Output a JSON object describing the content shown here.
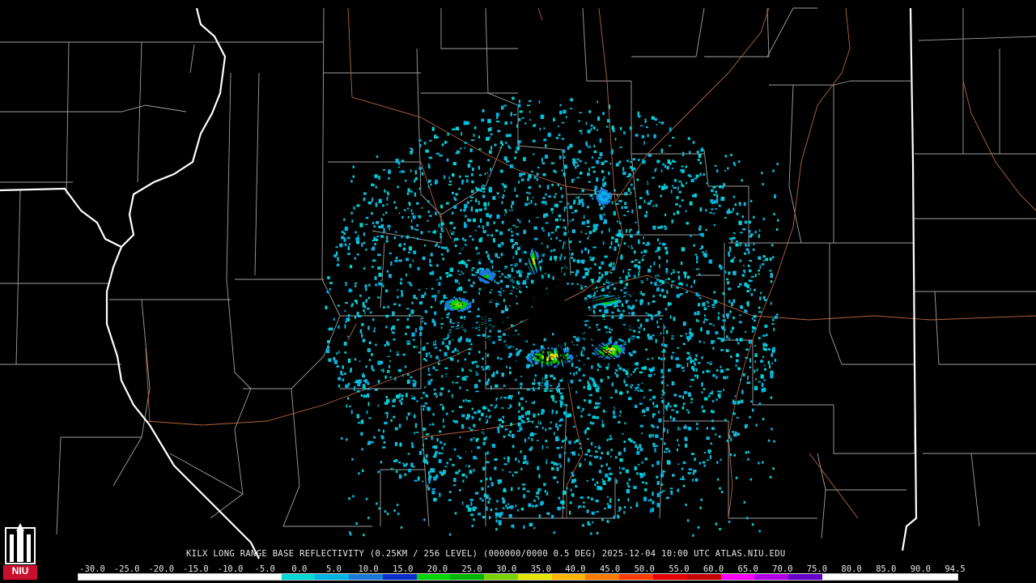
{
  "caption": "KILX LONG RANGE BASE REFLECTIVITY (0.25KM / 256 LEVEL) (000000/0000 0.5 DEG) 2025-12-04 10:00 UTC  ATLAS.NIU.EDU",
  "scale": {
    "ticks": [
      "-30.0",
      "-25.0",
      "-20.0",
      "-15.0",
      "-10.0",
      "-5.0",
      "0.0",
      "5.0",
      "10.0",
      "15.0",
      "20.0",
      "25.0",
      "30.0",
      "35.0",
      "40.0",
      "45.0",
      "50.0",
      "55.0",
      "60.0",
      "65.0",
      "70.0",
      "75.0",
      "80.0",
      "85.0",
      "90.0",
      "94.5"
    ],
    "colors": [
      "#ffffff",
      "#ffffff",
      "#ffffff",
      "#ffffff",
      "#ffffff",
      "#ffffff",
      "#00d7d7",
      "#00b4e6",
      "#1a7adc",
      "#0a2ecc",
      "#00d700",
      "#00b400",
      "#7ad200",
      "#e6e600",
      "#ffb400",
      "#ff7800",
      "#ff3c00",
      "#e60000",
      "#c80000",
      "#ff00ff",
      "#b400e6",
      "#6400c8",
      "#ffffff",
      "#ffffff",
      "#ffffff",
      "#ffffff"
    ]
  },
  "colors": {
    "background": "#000000",
    "county_lines": "#a0a0a0",
    "state_lines": "#ffffff",
    "roads": "#b4643c"
  },
  "logo": {
    "text": "NIU",
    "bg": "#c8102e"
  }
}
